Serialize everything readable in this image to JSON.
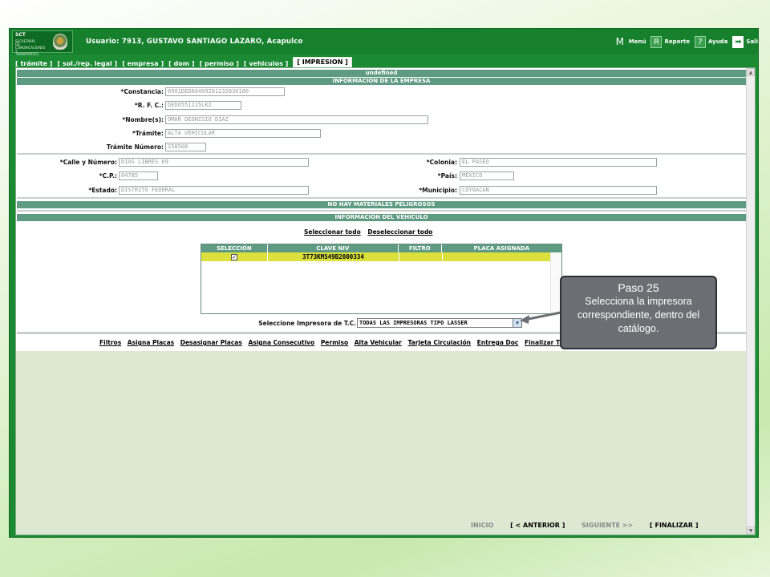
{
  "header": {
    "logo_text": "SCT",
    "logo_sub": "SECRETARÍA DE COMUNICACIONES Y TRANSPORTES",
    "user_label": "Usuario: 7913, GUSTAVO SANTIAGO LAZARO, Acapulco",
    "links": [
      {
        "icon": "M",
        "label": "Menú"
      },
      {
        "icon": "R",
        "label": "Reporte"
      },
      {
        "icon": "?",
        "label": "Ayuda"
      },
      {
        "icon": "➡",
        "label": "Sali"
      }
    ]
  },
  "tabs": [
    "[ trámite ]",
    "[ sol./rep. legal ]",
    "[ empresa ]",
    "[ dom ]",
    "[ permiso ]",
    "[ vehiculos ]",
    "[ IMPRESION ]"
  ],
  "page": {
    "undefined_bar": "undefined",
    "empresa_title": "INFORMACIÓN DE LA EMPRESA",
    "fields": {
      "constancia_label": "*Constancia:",
      "constancia_value": "0901DED00409201232830100",
      "rfc_label": "*R. F. C.:",
      "rfc_value": "DEDO551215LK2",
      "nombre_label": "*Nombre(s):",
      "nombre_value": "OMAR DEONISIO DIAZ",
      "tramite_label": "*Trámite:",
      "tramite_value": "ALTA VEHICULAR",
      "tramite_num_label": "Trámite Número:",
      "tramite_num_value": "258508",
      "calle_label": "*Calle y Número:",
      "calle_value": "DIAS LIBRES 69",
      "cp_label": "*C.P.:",
      "cp_value": "04785",
      "estado_label": "*Estado:",
      "estado_value": "DISTRITO FEDERAL",
      "colonia_label": "*Colonia:",
      "colonia_value": "EL PASEO",
      "pais_label": "*País:",
      "pais_value": "MÉXICO",
      "municipio_label": "*Municipio:",
      "municipio_value": "COYOACAN"
    },
    "materiales_bar": "NO HAY MATERIALES PELIGROSOS",
    "vehiculo_title": "INFORMACIÓN DEL VEHICULO",
    "select_all": "Seleccionar todo",
    "deselect_all": "Deseleccionar todo",
    "table": {
      "headers": [
        "SELECCIÓN",
        "CLAVE NIV",
        "FILTRO",
        "PLACA ASIGNADA"
      ],
      "rows": [
        {
          "checked": "✓",
          "niv": "3T73KMS49B2000334",
          "filtro": "",
          "placa": ""
        }
      ]
    },
    "printer_label": "Seleccione Impresora de T.C.",
    "printer_value": "TODAS LAS IMPRESORAS TIPO LASSER",
    "actions": [
      "Filtros",
      "Asigna Placas",
      "Desasignar Placas",
      "Asigna Consecutivo",
      "Permiso",
      "Alta Vehicular",
      "Tarjeta Circulación",
      "Entrega Doc",
      "Finalizar Trámite"
    ]
  },
  "footer": {
    "inicio": "INICIO",
    "anterior": "[ < ANTERIOR ]",
    "siguiente": "SIGUIENTE >>",
    "finalizar": "[ FINALIZAR ]"
  },
  "callout": {
    "title": "Paso 25",
    "body": "Selecciona la impresora correspondiente, dentro del catálogo."
  },
  "colors": {
    "frame_green": "#1b8a33",
    "bar_teal": "#5f9a83",
    "row_highlight": "#dbe03d",
    "callout_grey": "#6b6f73"
  }
}
